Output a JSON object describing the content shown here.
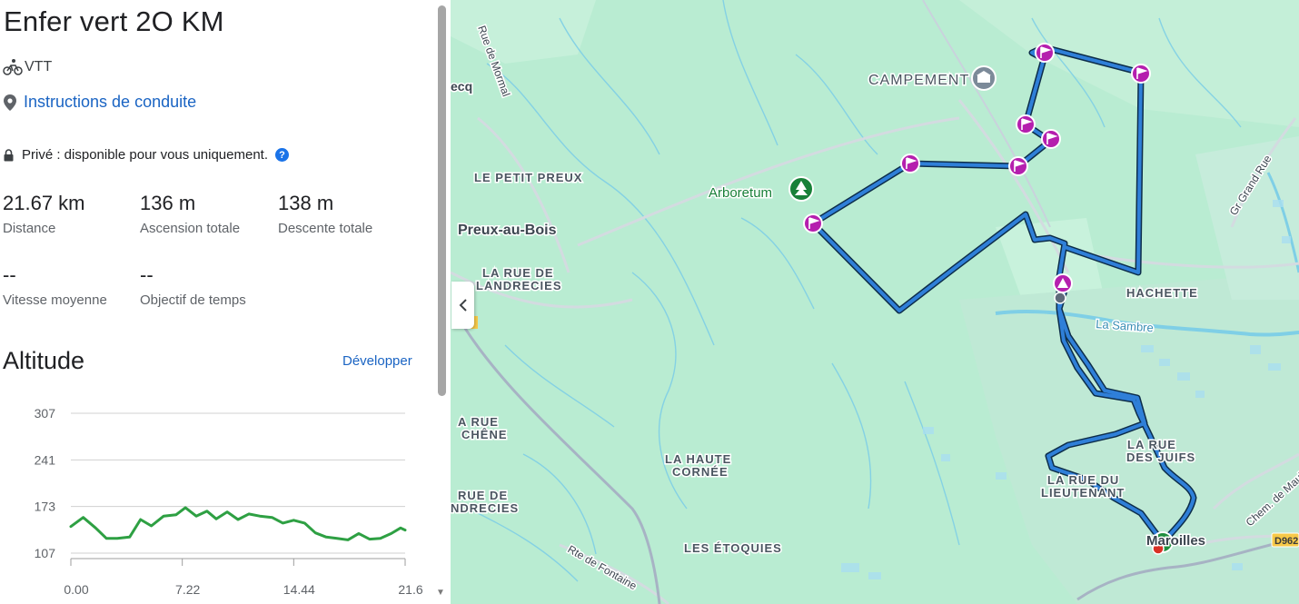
{
  "route": {
    "title": "Enfer vert 2O KM",
    "activity": "VTT",
    "directions_link": "Instructions de conduite",
    "privacy": "Privé : disponible pour vous uniquement.",
    "help": "?"
  },
  "stats": {
    "distance": {
      "value": "21.67 km",
      "label": "Distance"
    },
    "ascent": {
      "value": "136 m",
      "label": "Ascension totale"
    },
    "descent": {
      "value": "138 m",
      "label": "Descente totale"
    },
    "avg_speed": {
      "value": "--",
      "label": "Vitesse moyenne"
    },
    "time_goal": {
      "value": "--",
      "label": "Objectif de temps"
    }
  },
  "altitude": {
    "title": "Altitude",
    "expand": "Développer"
  },
  "chart_data": {
    "type": "line",
    "title": "Altitude",
    "ylim": [
      107,
      307
    ],
    "yticks": [
      "307",
      "241",
      "173",
      "107"
    ],
    "xticks": [
      "0.00",
      "7.22",
      "14.44",
      "21.6"
    ],
    "grid": true,
    "color": "#2ea043",
    "series": [
      {
        "x": [
          0,
          0.8,
          1.6,
          2.3,
          3.0,
          3.8,
          4.5,
          5.2,
          6.0,
          6.8,
          7.4,
          8.1,
          8.8,
          9.4,
          10.1,
          10.8,
          11.5,
          12.2,
          13.0,
          13.7,
          14.4,
          15.1,
          15.8,
          16.5,
          17.2,
          17.9,
          18.6,
          19.3,
          20.0,
          20.7,
          21.3,
          21.6
        ],
        "y": [
          145,
          158,
          143,
          128,
          128,
          130,
          155,
          146,
          160,
          162,
          172,
          160,
          167,
          156,
          166,
          155,
          163,
          160,
          158,
          150,
          154,
          150,
          136,
          130,
          128,
          126,
          135,
          127,
          128,
          135,
          143,
          140
        ]
      }
    ]
  },
  "map": {
    "labels": {
      "campement": "CAMPEMENT",
      "arboretum": "Arboretum",
      "le_petit_preux": "LE PETIT PREUX",
      "preux_au_bois": "Preux-au-Bois",
      "rue_de_landrecies_1": "LA RUE DE",
      "rue_de_landrecies_2": "LANDRECIES",
      "hachette": "HACHETTE",
      "la_sambre": "La Sambre",
      "la_rue_chene_1": "A RUE",
      "la_rue_chene_2": "CHÊNE",
      "la_haute_cornee_1": "LA HAUTE",
      "la_haute_cornee_2": "CORNÉE",
      "rue_de_ndrecies_1": "RUE DE",
      "rue_de_ndrecies_2": "NDRECIES",
      "la_rue_des_juifs_1": "LA RUE",
      "la_rue_des_juifs_2": "DES JUIFS",
      "la_rue_du_lieutenant_1": "LA RUE DU",
      "la_rue_du_lieutenant_2": "LIEUTENANT",
      "les_etoquies": "LES ÉTOQUIES",
      "maroilles": "Maroilles",
      "ecq": "ecq",
      "rue_de_mormal": "Rue de Mormal",
      "gr_grand_rue": "Gr Grand Rue",
      "rte_de_fontaine": "Rte de Fontaine",
      "chem_de_maul": "Chem. de Maul",
      "d962": "D962"
    }
  }
}
